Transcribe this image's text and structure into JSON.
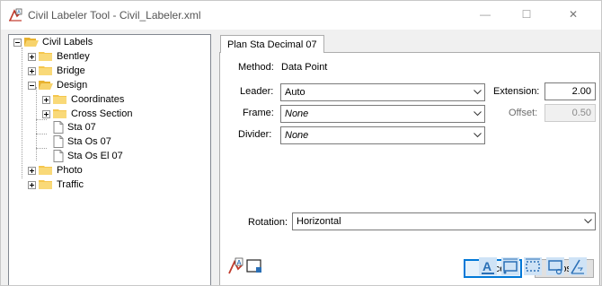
{
  "window": {
    "title": "Civil Labeler Tool - Civil_Labeler.xml",
    "minimize_glyph": "—",
    "maximize_glyph": "☐",
    "close_glyph": "✕"
  },
  "tree": {
    "root": "Civil Labels",
    "bentley": "Bentley",
    "bridge": "Bridge",
    "design": "Design",
    "coordinates": "Coordinates",
    "cross_section": "Cross Section",
    "sta07": "Sta 07",
    "staos07": "Sta Os 07",
    "staosel07": "Sta Os El 07",
    "photo": "Photo",
    "traffic": "Traffic"
  },
  "tab": {
    "label": "Plan Sta Decimal 07"
  },
  "form": {
    "method_label": "Method:",
    "method_value": "Data Point",
    "leader_label": "Leader:",
    "leader_value": "Auto",
    "frame_label": "Frame:",
    "frame_value": "None",
    "divider_label": "Divider:",
    "divider_value": "None",
    "extension_label": "Extension:",
    "extension_value": "2.00",
    "offset_label": "Offset:",
    "offset_value": "0.50",
    "rotation_label": "Rotation:",
    "rotation_value": "Horizontal"
  },
  "buttons": {
    "place": "Place",
    "close": "Close"
  },
  "colors": {
    "accent": "#0078d7",
    "folder": "#f5c64d",
    "icon_blue": "#2a6fb5"
  }
}
